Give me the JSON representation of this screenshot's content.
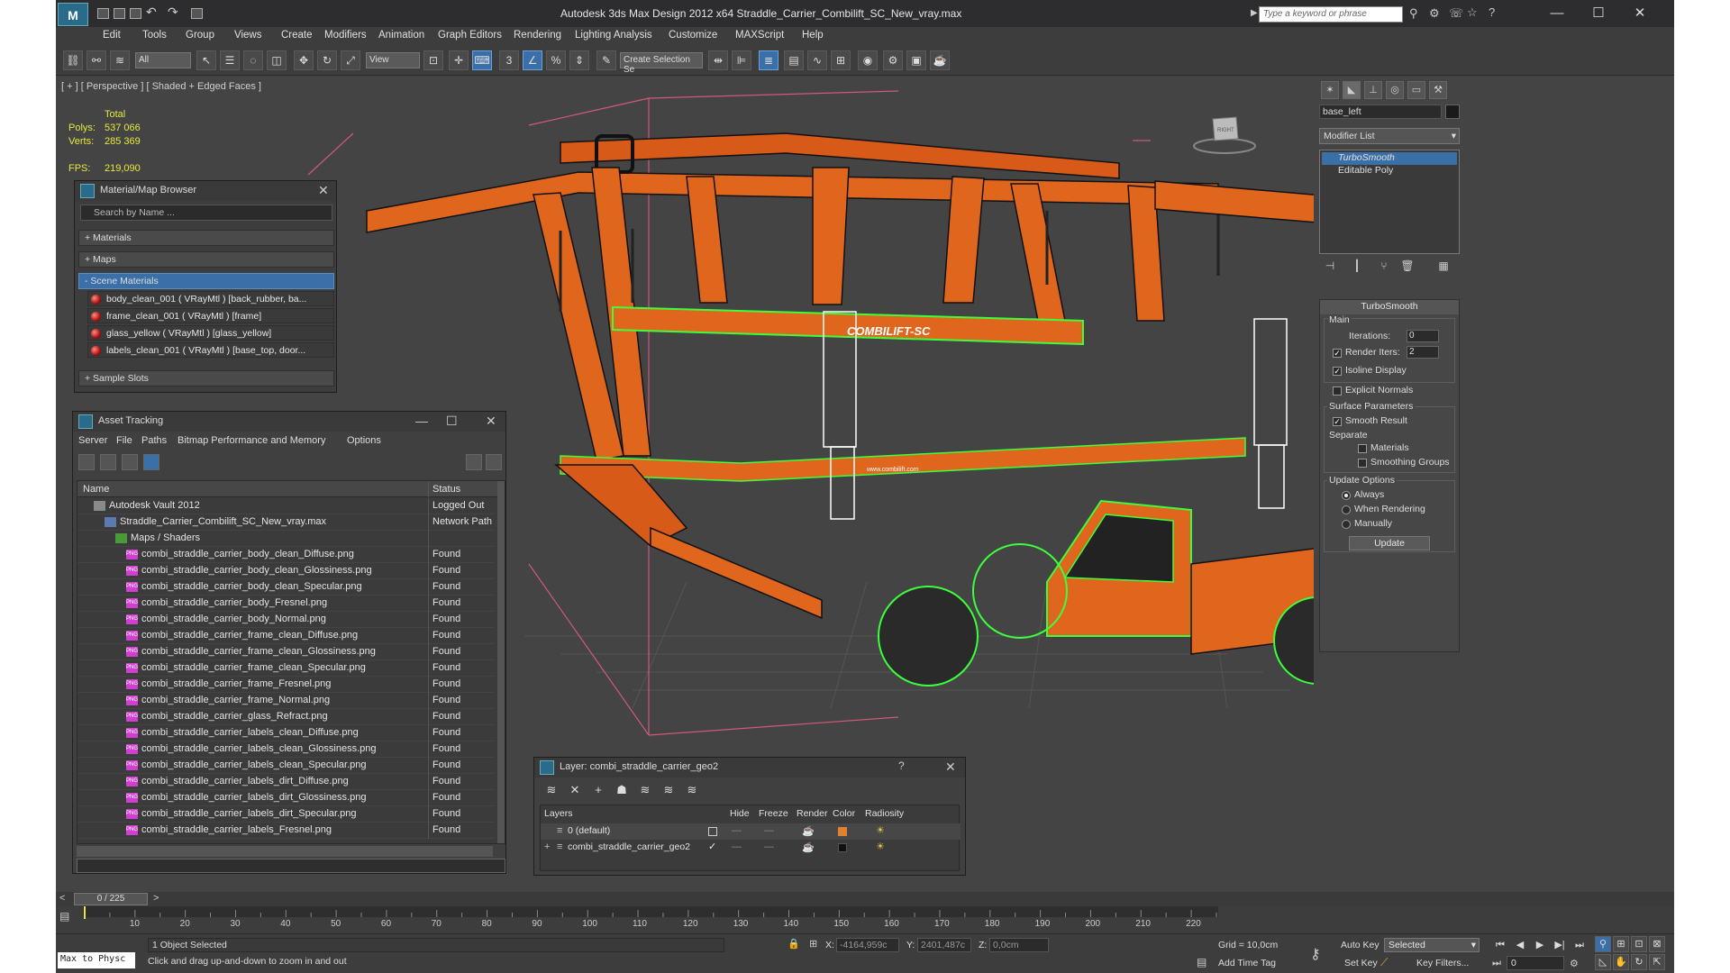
{
  "window": {
    "title": "Autodesk 3ds Max Design 2012 x64      Straddle_Carrier_Combilift_SC_New_vray.max",
    "search_placeholder": "Type a keyword or phrase",
    "minimize": "—",
    "maximize": "☐",
    "close": "✕"
  },
  "menu": [
    "Edit",
    "Tools",
    "Group",
    "Views",
    "Create",
    "Modifiers",
    "Animation",
    "Graph Editors",
    "Rendering",
    "Lighting Analysis",
    "Customize",
    "MAXScript",
    "Help"
  ],
  "toolbar": {
    "filter_select": "All",
    "ref_coord_select": "View",
    "selection_set": "Create Selection Se"
  },
  "viewport": {
    "label": "[ + ] [ Perspective ] [ Shaded + Edged Faces ]",
    "stats": {
      "header": "Total",
      "polys_label": "Polys:",
      "polys": "537 066",
      "verts_label": "Verts:",
      "verts": "285 369",
      "fps_label": "FPS:",
      "fps": "219,090"
    },
    "viewcube_label": "RIGHT",
    "banner_text": "COMBILIFT-SC",
    "small_banner": "www.combilift.com"
  },
  "material_browser": {
    "title": "Material/Map Browser",
    "search_placeholder": "Search by Name ...",
    "groups": {
      "materials": "+ Materials",
      "maps": "+ Maps",
      "scene": "- Scene Materials",
      "samples": "+ Sample Slots"
    },
    "scene_materials": [
      "body_clean_001  ( VRayMtl )  [back_rubber, ba...",
      "frame_clean_001  ( VRayMtl )  [frame]",
      "glass_yellow  ( VRayMtl )  [glass_yellow]",
      "labels_clean_001  ( VRayMtl )  [base_top, door..."
    ]
  },
  "asset_tracking": {
    "title": "Asset Tracking",
    "menu": [
      "Server",
      "File",
      "Paths",
      "Bitmap Performance and Memory",
      "Options"
    ],
    "columns": {
      "name": "Name",
      "status": "Status"
    },
    "rows": [
      {
        "name": "Autodesk Vault 2012",
        "status": "Logged Out",
        "indent": 1,
        "kind": "vault"
      },
      {
        "name": "Straddle_Carrier_Combilift_SC_New_vray.max",
        "status": "Network Path",
        "indent": 2,
        "kind": "file"
      },
      {
        "name": "Maps / Shaders",
        "status": "",
        "indent": 3,
        "kind": "folder"
      },
      {
        "name": "combi_straddle_carrier_body_clean_Diffuse.png",
        "status": "Found",
        "indent": 4,
        "kind": "png"
      },
      {
        "name": "combi_straddle_carrier_body_clean_Glossiness.png",
        "status": "Found",
        "indent": 4,
        "kind": "png"
      },
      {
        "name": "combi_straddle_carrier_body_clean_Specular.png",
        "status": "Found",
        "indent": 4,
        "kind": "png"
      },
      {
        "name": "combi_straddle_carrier_body_Fresnel.png",
        "status": "Found",
        "indent": 4,
        "kind": "png"
      },
      {
        "name": "combi_straddle_carrier_body_Normal.png",
        "status": "Found",
        "indent": 4,
        "kind": "png"
      },
      {
        "name": "combi_straddle_carrier_frame_clean_Diffuse.png",
        "status": "Found",
        "indent": 4,
        "kind": "png"
      },
      {
        "name": "combi_straddle_carrier_frame_clean_Glossiness.png",
        "status": "Found",
        "indent": 4,
        "kind": "png"
      },
      {
        "name": "combi_straddle_carrier_frame_clean_Specular.png",
        "status": "Found",
        "indent": 4,
        "kind": "png"
      },
      {
        "name": "combi_straddle_carrier_frame_Fresnel.png",
        "status": "Found",
        "indent": 4,
        "kind": "png"
      },
      {
        "name": "combi_straddle_carrier_frame_Normal.png",
        "status": "Found",
        "indent": 4,
        "kind": "png"
      },
      {
        "name": "combi_straddle_carrier_glass_Refract.png",
        "status": "Found",
        "indent": 4,
        "kind": "png"
      },
      {
        "name": "combi_straddle_carrier_labels_clean_Diffuse.png",
        "status": "Found",
        "indent": 4,
        "kind": "png"
      },
      {
        "name": "combi_straddle_carrier_labels_clean_Glossiness.png",
        "status": "Found",
        "indent": 4,
        "kind": "png"
      },
      {
        "name": "combi_straddle_carrier_labels_clean_Specular.png",
        "status": "Found",
        "indent": 4,
        "kind": "png"
      },
      {
        "name": "combi_straddle_carrier_labels_dirt_Diffuse.png",
        "status": "Found",
        "indent": 4,
        "kind": "png"
      },
      {
        "name": "combi_straddle_carrier_labels_dirt_Glossiness.png",
        "status": "Found",
        "indent": 4,
        "kind": "png"
      },
      {
        "name": "combi_straddle_carrier_labels_dirt_Specular.png",
        "status": "Found",
        "indent": 4,
        "kind": "png"
      },
      {
        "name": "combi_straddle_carrier_labels_Fresnel.png",
        "status": "Found",
        "indent": 4,
        "kind": "png"
      }
    ]
  },
  "layer_dialog": {
    "title": "Layer: combi_straddle_carrier_geo2",
    "help": "?",
    "columns": [
      "Layers",
      "Hide",
      "Freeze",
      "Render",
      "Color",
      "Radiosity"
    ],
    "rows": [
      {
        "name": "0 (default)",
        "color": "#e08030"
      },
      {
        "name": "combi_straddle_carrier_geo2",
        "color": "#111111"
      }
    ]
  },
  "command_panel": {
    "object_name": "base_left",
    "modifier_list": "Modifier List",
    "stack": [
      "TurboSmooth",
      "Editable Poly"
    ],
    "turbosmooth": {
      "title": "TurboSmooth",
      "main": "Main",
      "iterations_label": "Iterations:",
      "iterations": "0",
      "render_iters_label": "Render Iters:",
      "render_iters": "2",
      "isoline": "Isoline Display",
      "explicit": "Explicit Normals",
      "surface": "Surface Parameters",
      "smooth_result": "Smooth Result",
      "separate": "Separate",
      "materials": "Materials",
      "smoothing_groups": "Smoothing Groups",
      "update_options": "Update Options",
      "always": "Always",
      "when_rendering": "When Rendering",
      "manually": "Manually",
      "update_btn": "Update"
    }
  },
  "timeline": {
    "slider": "0 / 225",
    "ticks": [
      "10",
      "20",
      "30",
      "40",
      "50",
      "60",
      "70",
      "80",
      "90",
      "100",
      "110",
      "120",
      "130",
      "140",
      "150",
      "160",
      "170",
      "180",
      "190",
      "200",
      "210",
      "220"
    ]
  },
  "status": {
    "maxscript": "Max to Physc",
    "selection": "1 Object Selected",
    "prompt": "Click and drag up-and-down to zoom in and out",
    "x_label": "X:",
    "x": "-4164,959c",
    "y_label": "Y:",
    "y": "2401,487c",
    "z_label": "Z:",
    "z": "0,0cm",
    "grid": "Grid = 10,0cm",
    "add_time_tag": "Add Time Tag",
    "auto_key": "Auto Key",
    "set_key": "Set Key",
    "key_mode": "Selected",
    "key_filters": "Key Filters...",
    "frame": "0"
  },
  "colors": {
    "accent": "#3b6fa8",
    "frame_orange": "#e0661e",
    "wire_green": "#3cff3c",
    "stats_yellow": "#e8e840",
    "viewport_bg": "#444444"
  }
}
